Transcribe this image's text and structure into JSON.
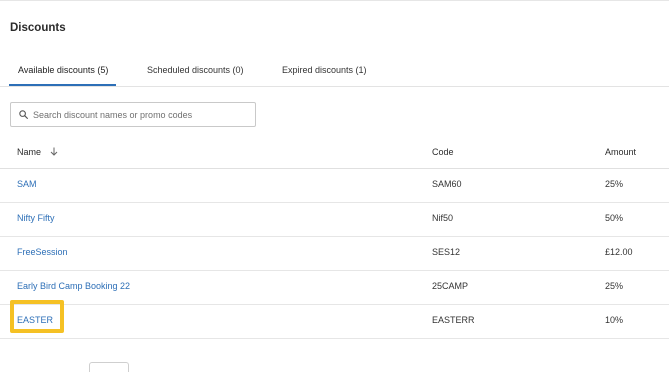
{
  "page": {
    "title": "Discounts"
  },
  "tabs": [
    {
      "label": "Available discounts (5)",
      "active": true
    },
    {
      "label": "Scheduled discounts (0)",
      "active": false
    },
    {
      "label": "Expired discounts (1)",
      "active": false
    }
  ],
  "search": {
    "placeholder": "Search discount names or promo codes",
    "value": ""
  },
  "table": {
    "columns": {
      "name": "Name",
      "code": "Code",
      "amount": "Amount"
    },
    "sort": {
      "column": "name",
      "direction": "desc",
      "icon": "arrow-down-icon"
    },
    "rows": [
      {
        "name": "SAM",
        "code": "SAM60",
        "amount": "25%"
      },
      {
        "name": "Nifty Fifty",
        "code": "Nif50",
        "amount": "50%"
      },
      {
        "name": "FreeSession",
        "code": "SES12",
        "amount": "£12.00"
      },
      {
        "name": "Early Bird Camp Booking 22",
        "code": "25CAMP",
        "amount": "25%"
      },
      {
        "name": "EASTER",
        "code": "EASTERR",
        "amount": "10%"
      }
    ]
  },
  "colors": {
    "link": "#2d6fb7",
    "tab_indicator": "#2d6fb7",
    "highlight": "#f5c124"
  },
  "icons": {
    "search": "search-icon",
    "sort": "arrow-down-icon"
  }
}
